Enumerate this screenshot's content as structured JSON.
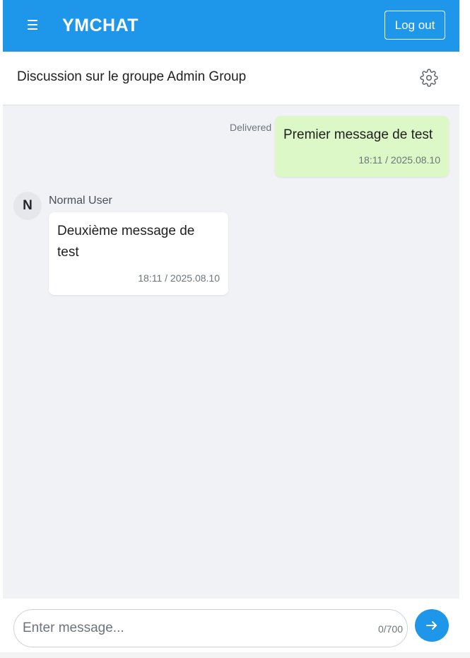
{
  "header": {
    "brand": "YMCHAT",
    "logout_label": "Log out",
    "menu_icon": "hamburger-menu-icon"
  },
  "group": {
    "title": "Discussion sur le groupe Admin Group",
    "settings_icon": "gear-icon"
  },
  "messages": [
    {
      "direction": "sent",
      "text": "Premier message de test",
      "time": "18:11 / 2025.08.10",
      "status": "Delivered"
    },
    {
      "direction": "received",
      "sender": "Normal User",
      "avatar_initial": "N",
      "text": "Deuxième message de test",
      "time": "18:11 / 2025.08.10"
    }
  ],
  "composer": {
    "placeholder": "Enter message...",
    "value": "",
    "char_count": "0/700",
    "send_icon": "arrow-right-icon"
  },
  "colors": {
    "primary": "#1e96ea",
    "sent_bubble": "#dcf8c6",
    "chat_background": "#f1f2f5"
  }
}
